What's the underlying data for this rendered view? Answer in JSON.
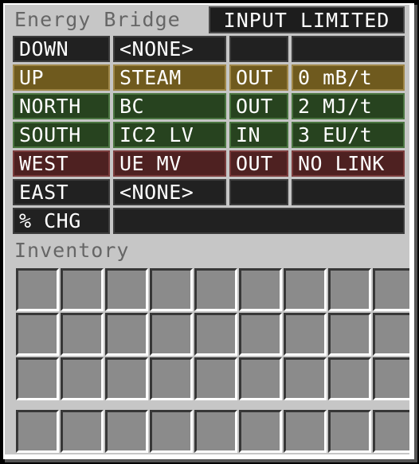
{
  "window": {
    "title": "Energy Bridge",
    "status": "INPUT LIMITED"
  },
  "colors": {
    "panel": "#c6c6c6",
    "title_text": "#666666",
    "slot_fill": "#8b8b8b",
    "slot_shadow": "#373737",
    "slot_highlight": "#ffffff",
    "cell_none_bg": "#212121",
    "cell_none_border": "#3c3c3c",
    "cell_gold_bg": "#6f5a1e",
    "cell_gold_border": "#9e8647",
    "cell_green_bg": "#27431f",
    "cell_green_border": "#4a7540",
    "cell_red_bg": "#4e2121",
    "cell_red_border": "#7a3b3b"
  },
  "side_table": {
    "rows": [
      {
        "direction": "DOWN",
        "link": "<NONE>",
        "io": "",
        "rate": "",
        "theme": "theme-none"
      },
      {
        "direction": "UP",
        "link": "STEAM",
        "io": "OUT",
        "rate": "0 mB/t",
        "theme": "theme-gold"
      },
      {
        "direction": "NORTH",
        "link": "BC",
        "io": "OUT",
        "rate": "2 MJ/t",
        "theme": "theme-green"
      },
      {
        "direction": "SOUTH",
        "link": "IC2 LV",
        "io": "IN",
        "rate": "3 EU/t",
        "theme": "theme-green"
      },
      {
        "direction": "WEST",
        "link": "UE MV",
        "io": "OUT",
        "rate": "NO LINK",
        "theme": "theme-red"
      },
      {
        "direction": "EAST",
        "link": "<NONE>",
        "io": "",
        "rate": "",
        "theme": "theme-none"
      }
    ],
    "percent_charge": {
      "label": "% CHG",
      "value": "",
      "theme": "theme-none"
    }
  },
  "inventory": {
    "label": "Inventory",
    "main_rows": 3,
    "main_columns": 9,
    "hotbar_slots": 9,
    "slots_empty": true
  }
}
